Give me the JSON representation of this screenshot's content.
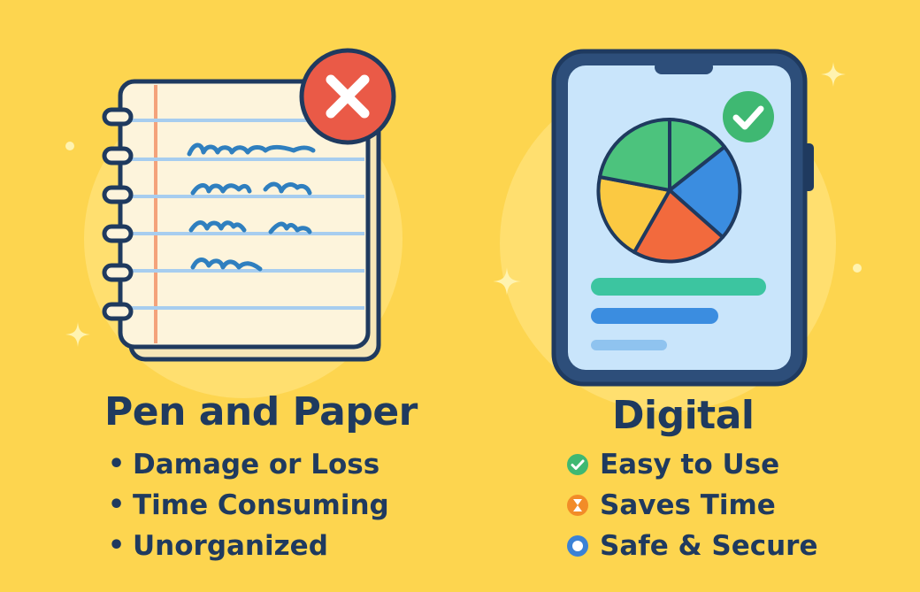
{
  "left_panel": {
    "title": "Pen and Paper",
    "items": [
      {
        "label": "Damage or Loss"
      },
      {
        "label": "Time Consuming"
      },
      {
        "label": "Unorganized"
      }
    ],
    "badge_icon": "x-icon",
    "badge_color": "#ea5a47"
  },
  "right_panel": {
    "title": "Digital",
    "items": [
      {
        "label": "Easy to Use",
        "icon": "check-circle-icon",
        "color": "#3fb872"
      },
      {
        "label": "Saves Time",
        "icon": "hourglass-icon",
        "color": "#f28c28"
      },
      {
        "label": "Safe & Secure",
        "icon": "shield-icon",
        "color": "#3b82d6"
      }
    ],
    "badge_icon": "check-icon",
    "badge_color": "#3fb872"
  },
  "colors": {
    "background": "#fdd54f",
    "text": "#1f3a5f",
    "pie_green": "#4cc37d",
    "pie_blue": "#3b8de0",
    "pie_orange": "#f26a3d",
    "pie_yellow": "#fbc942"
  }
}
